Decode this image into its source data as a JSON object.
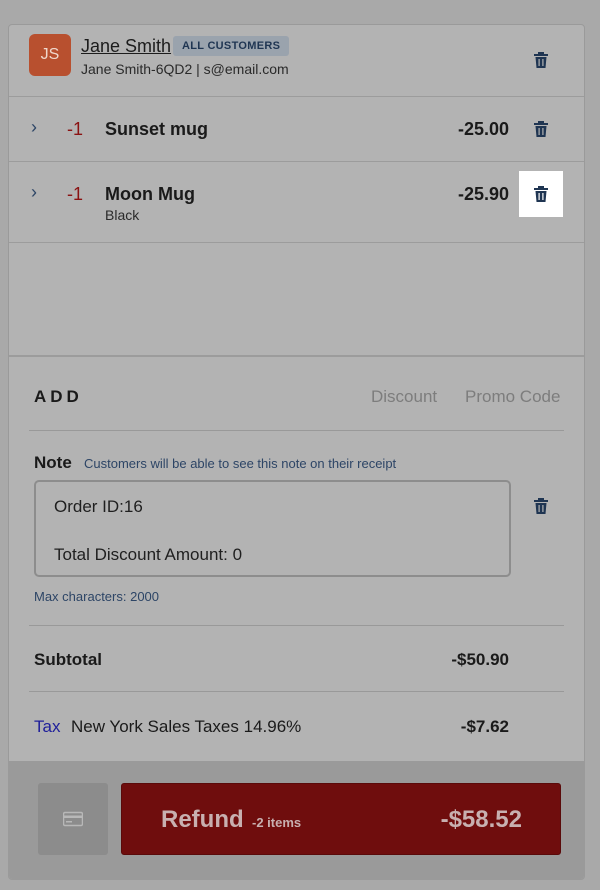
{
  "customer": {
    "initials": "JS",
    "name": "Jane Smith",
    "tag": "ALL CUSTOMERS",
    "details": "Jane Smith-6QD2 | s@email.com"
  },
  "items": [
    {
      "qty": "-1",
      "name": "Sunset mug",
      "variant": "",
      "price": "-25.00"
    },
    {
      "qty": "-1",
      "name": "Moon Mug",
      "variant": "Black",
      "price": "-25.90"
    }
  ],
  "add": {
    "label": "ADD",
    "discount": "Discount",
    "promo": "Promo Code"
  },
  "note": {
    "label": "Note",
    "hint": "Customers will be able to see this note on their receipt",
    "line1": "Order ID:16",
    "line2": "Total Discount Amount: 0",
    "max": "Max characters: 2000"
  },
  "summary": {
    "subtotal_label": "Subtotal",
    "subtotal_value": "-$50.90",
    "tax_link": "Tax",
    "tax_desc": "New York Sales Taxes 14.96%",
    "tax_value": "-$7.62"
  },
  "footer": {
    "refund_label": "Refund",
    "refund_count": "-2 items",
    "refund_total": "-$58.52"
  },
  "icons": {
    "chevron": "›",
    "trash": "trash-icon",
    "card": "credit-card-icon"
  },
  "colors": {
    "accent": "#2d4566",
    "refund": "#6f0d0d",
    "avatar": "#b8502f"
  }
}
